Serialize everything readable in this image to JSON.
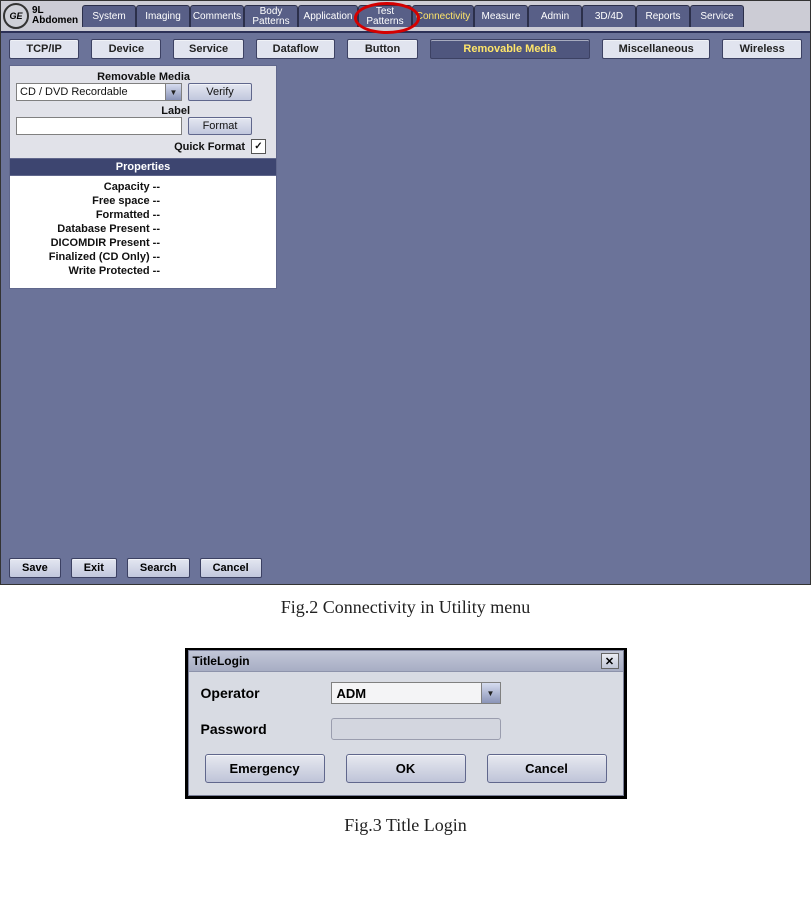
{
  "top": {
    "logo_text": "GE",
    "probe_line1": "9L",
    "probe_line2": "Abdomen",
    "tabs": {
      "system": "System",
      "imaging": "Imaging",
      "comments": "Comments",
      "body_patterns": "Body\nPatterns",
      "application": "Application",
      "test_patterns": "Test\nPatterns",
      "connectivity": "Connectivity",
      "measure": "Measure",
      "admin": "Admin",
      "three_d": "3D/4D",
      "reports": "Reports",
      "service": "Service"
    }
  },
  "subtabs": {
    "tcpip": "TCP/IP",
    "device": "Device",
    "service": "Service",
    "dataflow": "Dataflow",
    "button": "Button",
    "removable_media": "Removable Media",
    "misc": "Miscellaneous",
    "wireless": "Wireless"
  },
  "media": {
    "label_removable": "Removable Media",
    "dropdown_value": "CD / DVD Recordable",
    "label_label": "Label",
    "label_value": "",
    "verify_btn": "Verify",
    "format_btn": "Format",
    "quick_format": "Quick Format",
    "quick_format_checked": "✓",
    "props_header": "Properties",
    "prop_capacity": "Capacity --",
    "prop_free": "Free space --",
    "prop_formatted": "Formatted --",
    "prop_db": "Database Present --",
    "prop_dicomdir": "DICOMDIR Present --",
    "prop_finalized": "Finalized (CD Only) --",
    "prop_write": "Write Protected --"
  },
  "bottom": {
    "save": "Save",
    "exit": "Exit",
    "search": "Search",
    "cancel": "Cancel"
  },
  "caption1": "Fig.2 Connectivity in Utility menu",
  "login": {
    "title": "TitleLogin",
    "close": "✕",
    "operator_label": "Operator",
    "operator_value": "ADM",
    "password_label": "Password",
    "emergency_btn": "Emergency",
    "ok_btn": "OK",
    "cancel_btn": "Cancel"
  },
  "caption2": "Fig.3 Title Login"
}
